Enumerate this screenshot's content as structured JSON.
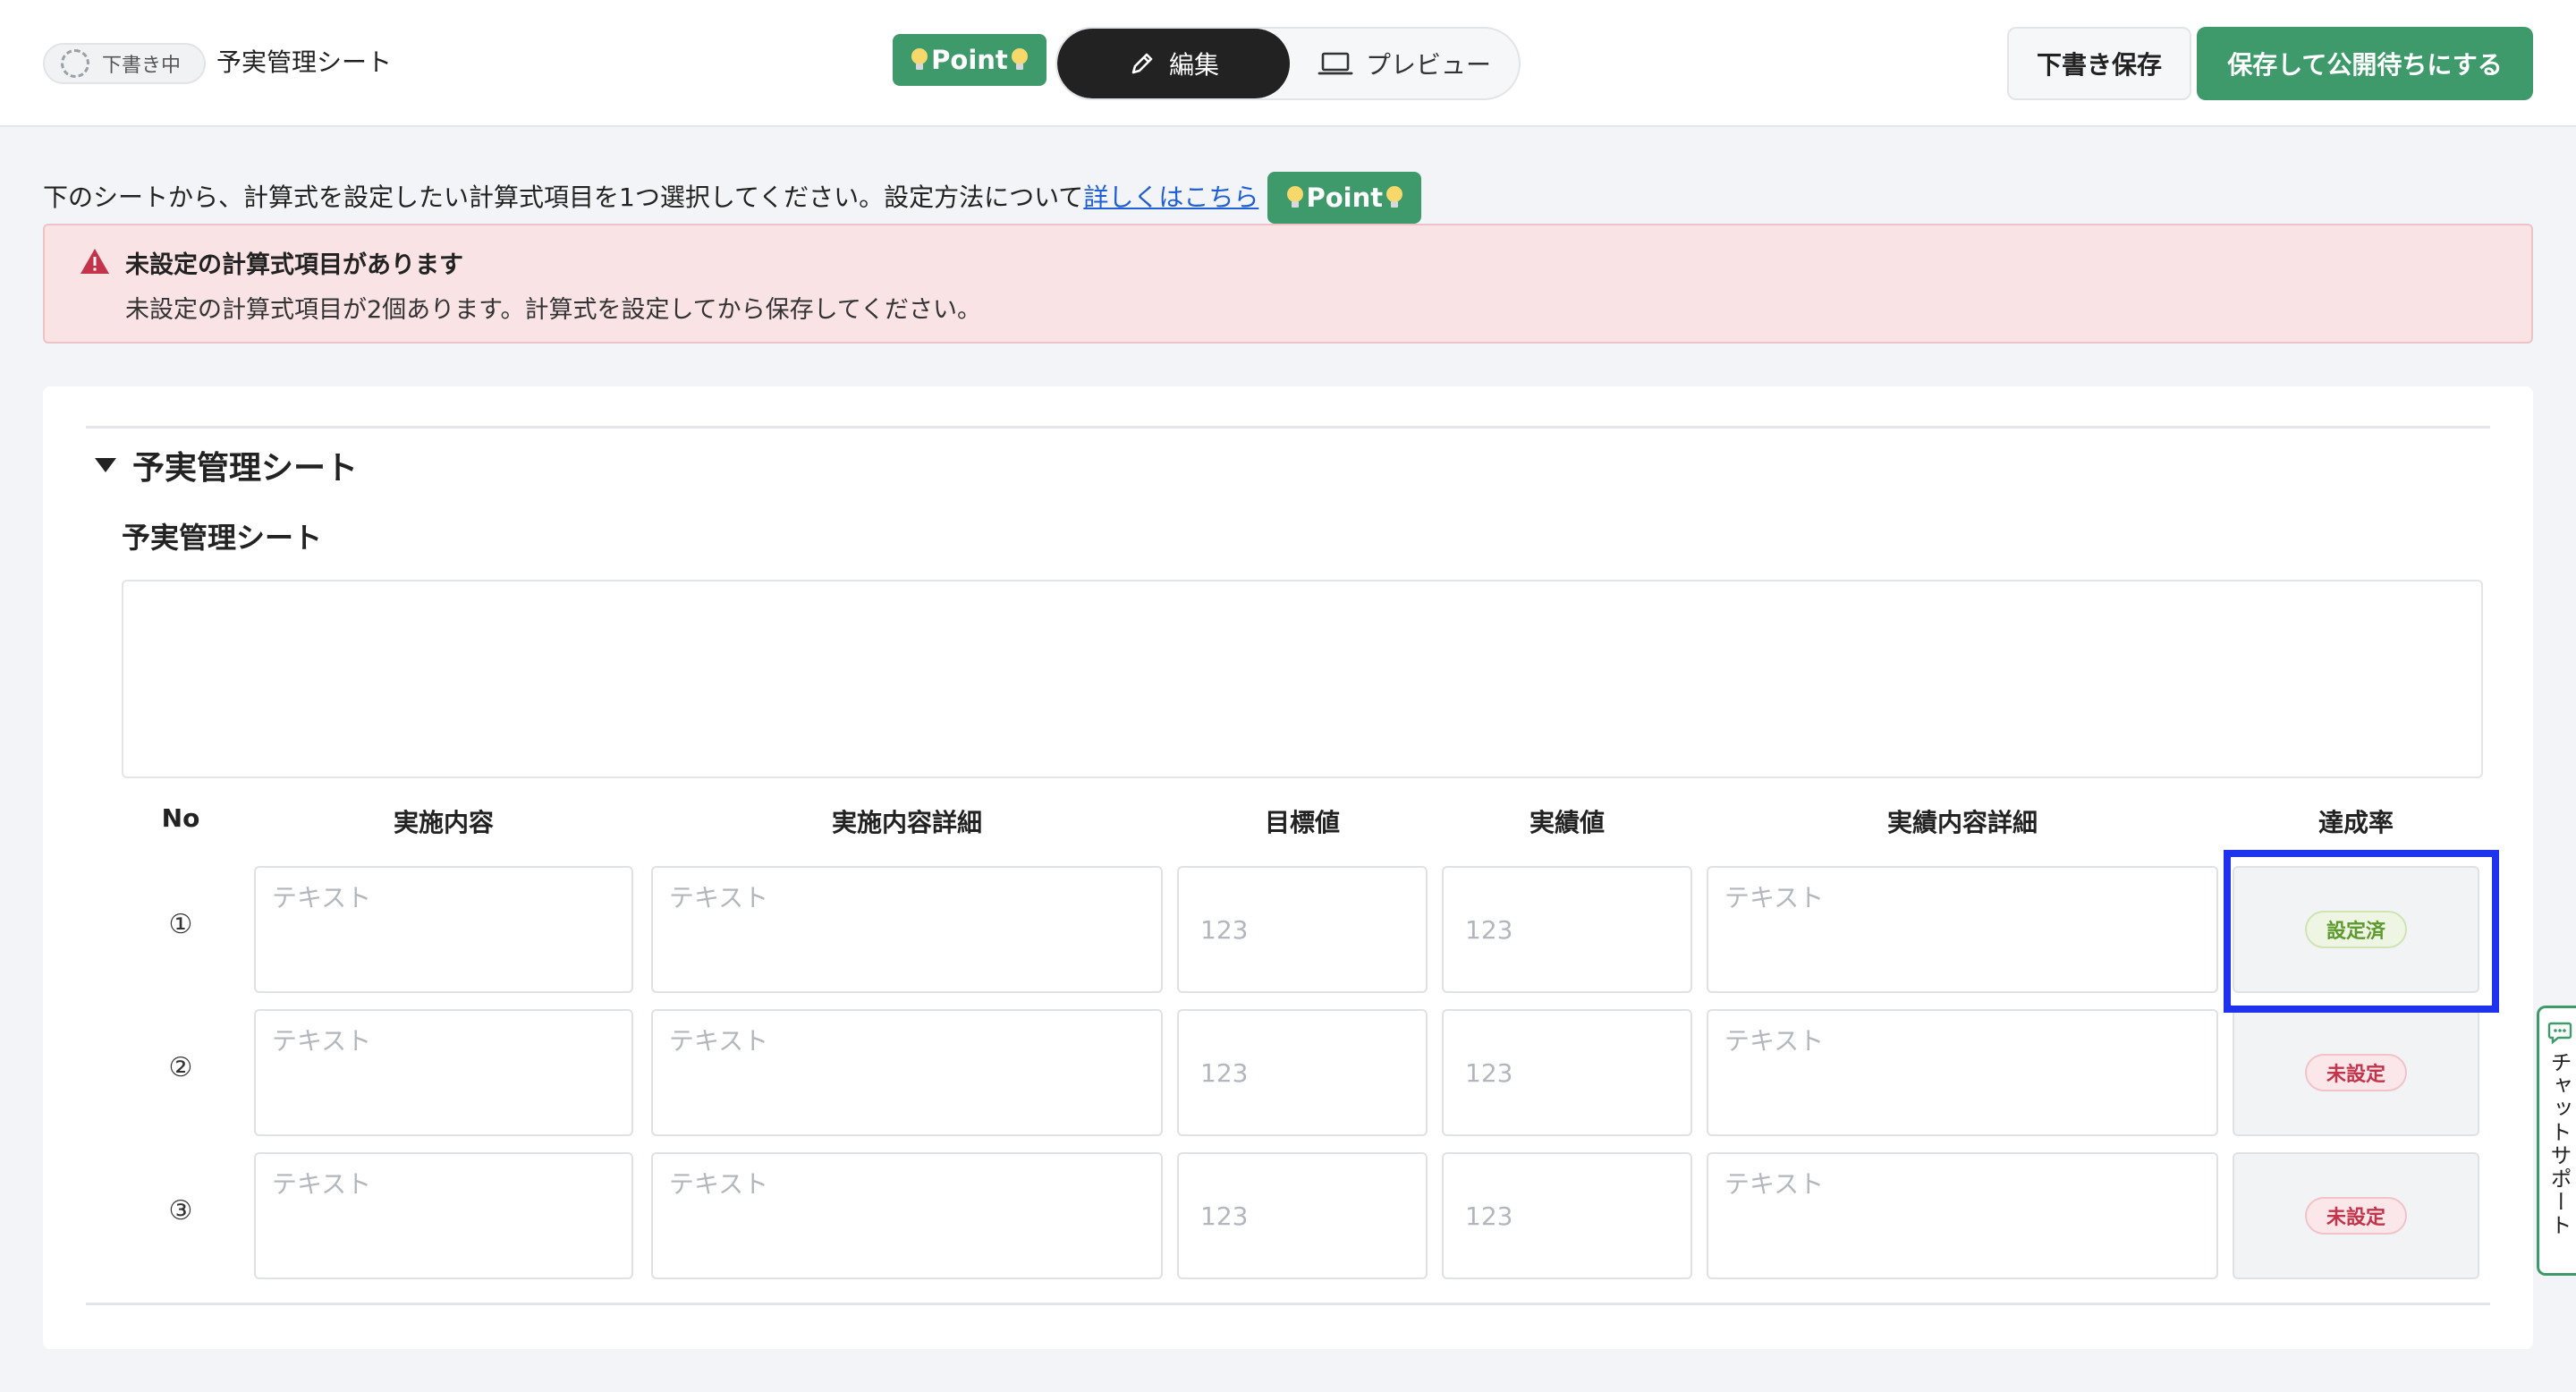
{
  "header": {
    "status_label": "下書き中",
    "doc_title": "予実管理シート",
    "point_label": "Point",
    "mode_edit_label": "編集",
    "mode_preview_label": "プレビュー",
    "draft_save_label": "下書き保存",
    "publish_label": "保存して公開待ちにする"
  },
  "instruction": {
    "text": "下のシートから、計算式を設定したい計算式項目を1つ選択してください。設定方法について",
    "link": "詳しくはこちら",
    "point_label": "Point"
  },
  "alert": {
    "title": "未設定の計算式項目があります",
    "message": "未設定の計算式項目が2個あります。計算式を設定してから保存してください。"
  },
  "section": {
    "title": "予実管理シート",
    "sheet_label": "予実管理シート"
  },
  "table": {
    "columns": [
      "No",
      "実施内容",
      "実施内容詳細",
      "目標値",
      "実績値",
      "実績内容詳細",
      "達成率"
    ],
    "rows": [
      {
        "no": "①",
        "text_placeholder": "テキスト",
        "num_placeholder": "123",
        "rate_status": "設定済"
      },
      {
        "no": "②",
        "text_placeholder": "テキスト",
        "num_placeholder": "123",
        "rate_status": "未設定"
      },
      {
        "no": "③",
        "text_placeholder": "テキスト",
        "num_placeholder": "123",
        "rate_status": "未設定"
      }
    ]
  },
  "chat_support": {
    "label": "チャットサポート"
  },
  "colors": {
    "brand_green": "#3f9a6b",
    "alert_bg": "#f9e3e5",
    "highlight_blue": "#1f33ee",
    "status_ok": "#5d9a2e",
    "status_ng": "#c3344a"
  }
}
